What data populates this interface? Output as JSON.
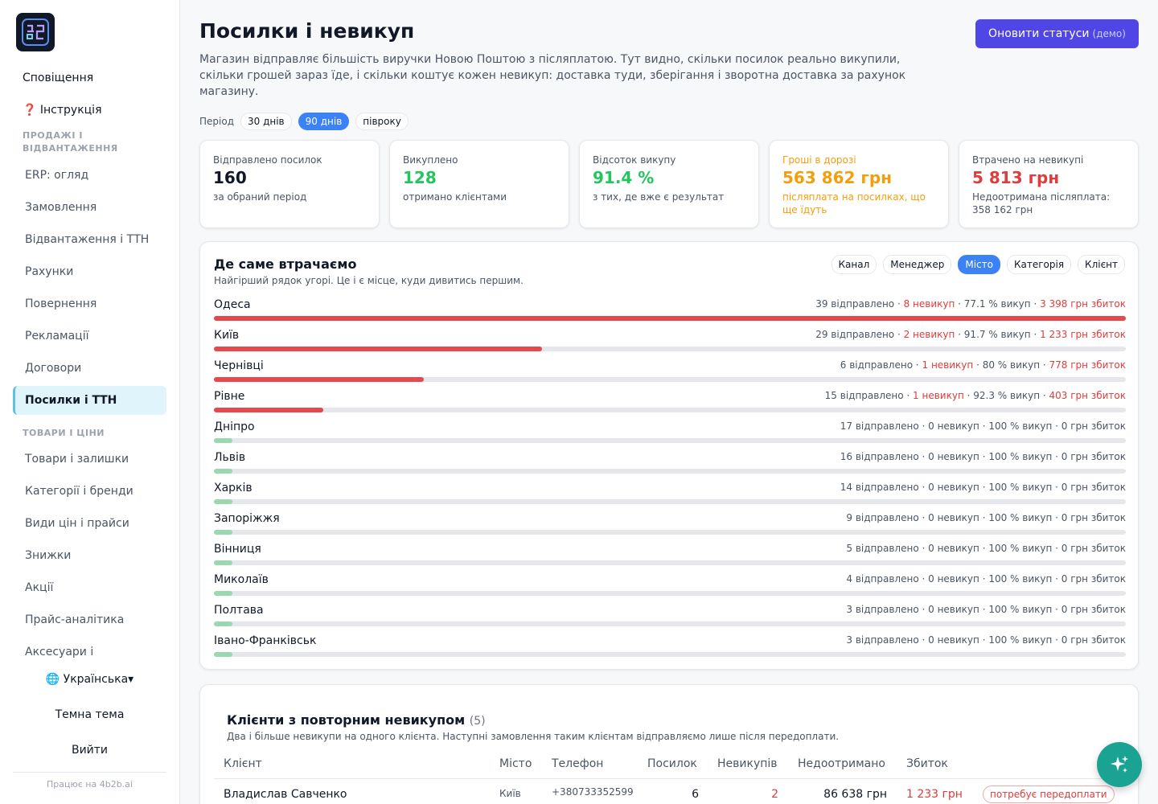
{
  "sidebar": {
    "logo_text": "4B2B",
    "top_items": [
      "Сповіщення",
      "❓ Інструкція"
    ],
    "section_sales": "ПРОДАЖІ І ВІДВАНТАЖЕННЯ",
    "sales_items": [
      "ERP: огляд",
      "Замовлення",
      "Відвантаження і ТТН",
      "Рахунки",
      "Повернення",
      "Рекламації",
      "Договори",
      "Посилки і ТТН"
    ],
    "section_goods": "ТОВАРИ І ЦІНИ",
    "goods_items": [
      "Товари і залишки",
      "Категорії і бренди",
      "Види цін і прайси",
      "Знижки",
      "Акції",
      "Прайс-аналітика",
      "Аксесуари і"
    ],
    "language": "🌐 Українська▾",
    "theme": "Темна тема",
    "logout": "Вийти",
    "footer": "Працює на 4b2b.ai"
  },
  "header": {
    "title": "Посилки і невикуп",
    "description": "Магазин відправляє більшість виручки Новою Поштою з післяплатою. Тут видно, скільки посилок реально викупили, скільки грошей зараз їде, і скільки коштує кожен невикуп: доставка туди, зберігання і зворотна доставка за рахунок магазину.",
    "refresh_label": "Оновити статуси",
    "refresh_demo": "(демо)",
    "period_label": "Період",
    "periods": [
      "30 днів",
      "90 днів",
      "півроку"
    ],
    "active_period": "90 днів"
  },
  "kpis": [
    {
      "label": "Відправлено посилок",
      "value": "160",
      "sub": "за обраний період",
      "color": "#111827"
    },
    {
      "label": "Викуплено",
      "value": "128",
      "sub": "отримано клієнтами",
      "color": "#22c55e"
    },
    {
      "label": "Відсоток викупу",
      "value": "91.4 %",
      "sub": "з тих, де вже є результат",
      "color": "#22c55e"
    },
    {
      "label": "Гроші в дорозі",
      "value": "563 862 грн",
      "sub": "післяплата на посилках, що ще їдуть",
      "color": "#f59e0b"
    },
    {
      "label": "Втрачено на невикупі",
      "value": "5 813 грн",
      "sub": "Недоотримана післяплата: 358 162 грн",
      "color": "#e23b3b"
    }
  ],
  "loss": {
    "title": "Де саме втрачаємо",
    "subtitle": "Найгірший рядок угорі. Це і є місце, куди дивитись першим.",
    "group_tabs": [
      "Канал",
      "Менеджер",
      "Місто",
      "Категорія",
      "Клієнт"
    ],
    "active_tab": "Місто",
    "colors": {
      "loss": "#e5484d",
      "ok": "#9ad8b0"
    },
    "rows": [
      {
        "name": "Одеса",
        "sent": "39 відправлено",
        "refused": "8 невикуп",
        "pct": "77.1 % викуп",
        "loss": "3 398 грн збиток",
        "share": 1.0,
        "bad": true
      },
      {
        "name": "Київ",
        "sent": "29 відправлено",
        "refused": "2 невикуп",
        "pct": "91.7 % викуп",
        "loss": "1 233 грн збиток",
        "share": 0.36,
        "bad": true
      },
      {
        "name": "Чернівці",
        "sent": "6 відправлено",
        "refused": "1 невикуп",
        "pct": "80 % викуп",
        "loss": "778 грн збиток",
        "share": 0.23,
        "bad": true
      },
      {
        "name": "Рівне",
        "sent": "15 відправлено",
        "refused": "1 невикуп",
        "pct": "92.3 % викуп",
        "loss": "403 грн збиток",
        "share": 0.12,
        "bad": true
      },
      {
        "name": "Дніпро",
        "sent": "17 відправлено",
        "refused": "0 невикуп",
        "pct": "100 % викуп",
        "loss": "0 грн збиток",
        "share": 0.02,
        "bad": false
      },
      {
        "name": "Львів",
        "sent": "16 відправлено",
        "refused": "0 невикуп",
        "pct": "100 % викуп",
        "loss": "0 грн збиток",
        "share": 0.02,
        "bad": false
      },
      {
        "name": "Харків",
        "sent": "14 відправлено",
        "refused": "0 невикуп",
        "pct": "100 % викуп",
        "loss": "0 грн збиток",
        "share": 0.02,
        "bad": false
      },
      {
        "name": "Запоріжжя",
        "sent": "9 відправлено",
        "refused": "0 невикуп",
        "pct": "100 % викуп",
        "loss": "0 грн збиток",
        "share": 0.02,
        "bad": false
      },
      {
        "name": "Вінниця",
        "sent": "5 відправлено",
        "refused": "0 невикуп",
        "pct": "100 % викуп",
        "loss": "0 грн збиток",
        "share": 0.02,
        "bad": false
      },
      {
        "name": "Миколаїв",
        "sent": "4 відправлено",
        "refused": "0 невикуп",
        "pct": "100 % викуп",
        "loss": "0 грн збиток",
        "share": 0.02,
        "bad": false
      },
      {
        "name": "Полтава",
        "sent": "3 відправлено",
        "refused": "0 невикуп",
        "pct": "100 % викуп",
        "loss": "0 грн збиток",
        "share": 0.02,
        "bad": false
      },
      {
        "name": "Івано-Франківськ",
        "sent": "3 відправлено",
        "refused": "0 невикуп",
        "pct": "100 % викуп",
        "loss": "0 грн збиток",
        "share": 0.02,
        "bad": false
      }
    ]
  },
  "clients": {
    "title": "Клієнти з повторним невикупом",
    "count": "(5)",
    "subtitle": "Два і більше невикупи на одного клієнта. Наступні замовлення таким клієнтам відправляємо лише після передоплати.",
    "columns": [
      "Клієнт",
      "Місто",
      "Телефон",
      "Посилок",
      "Невикупів",
      "Недоотримано",
      "Збиток"
    ],
    "rows": [
      {
        "client": "Владислав Савченко",
        "city": "Київ",
        "phone": "+380733352599",
        "parcels": "6",
        "refused": "2",
        "unreceived": "86 638 грн",
        "loss": "1 233 грн",
        "status": "потребує передоплати"
      }
    ]
  }
}
